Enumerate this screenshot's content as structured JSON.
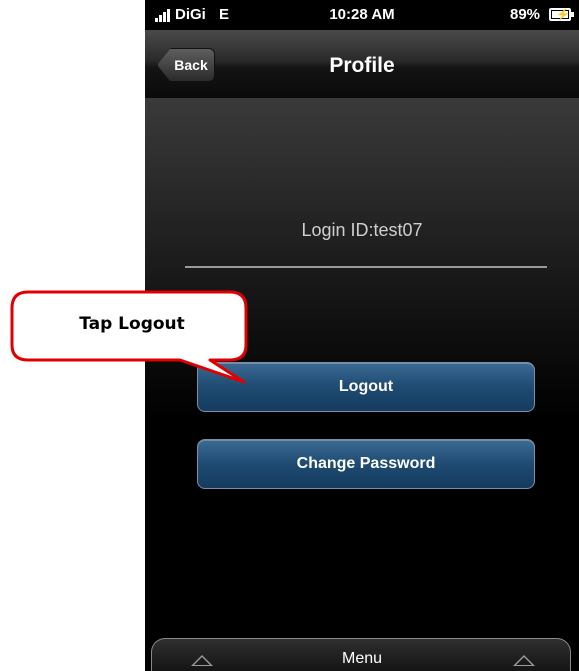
{
  "status_bar": {
    "carrier": "DiGi",
    "network": "E",
    "time": "10:28 AM",
    "battery": "89%"
  },
  "nav": {
    "back_label": "Back",
    "title": "Profile"
  },
  "profile": {
    "login_id": "Login ID:test07"
  },
  "buttons": {
    "logout": "Logout",
    "change_password": "Change Password"
  },
  "menu": {
    "label": "Menu"
  },
  "callout": {
    "text": "Tap Logout",
    "border_color": "#e00000"
  },
  "colors": {
    "button_blue": "#1f4b72",
    "background": "#000000"
  }
}
